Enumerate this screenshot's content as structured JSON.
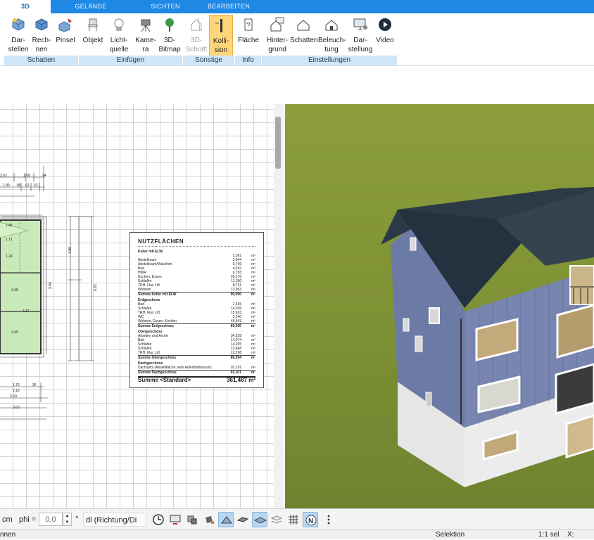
{
  "tabs": [
    {
      "label": "3D"
    },
    {
      "label": "GELÄNDE"
    },
    {
      "label": "SICHTEN"
    },
    {
      "label": "BEARBEITEN"
    }
  ],
  "ribbon": {
    "buttons": [
      {
        "label": "Dar-\nstellen",
        "icon": "cube-view-icon"
      },
      {
        "label": "Rech-\nnen",
        "icon": "cube-render-icon"
      },
      {
        "label": "Pinsel",
        "icon": "brush-cube-icon"
      },
      {
        "label": "Objekt",
        "icon": "chair-icon"
      },
      {
        "label": "Licht-\nquelle",
        "icon": "lightbulb-icon"
      },
      {
        "label": "Kame-\nra",
        "icon": "camera-icon"
      },
      {
        "label": "3D-\nBitmap",
        "icon": "tree-icon"
      },
      {
        "label": "3D-\nSchnitt",
        "icon": "section-house-icon"
      },
      {
        "label": "Kolli-\nsion",
        "icon": "collision-icon"
      },
      {
        "label": "Fläche",
        "icon": "area-info-icon"
      },
      {
        "label": "Hinter-\ngrund",
        "icon": "background-house-icon"
      },
      {
        "label": "Schatten",
        "icon": "shadow-house-icon"
      },
      {
        "label": "Beleuch-\ntung",
        "icon": "lighting-house-icon"
      },
      {
        "label": "Dar-\nstellung",
        "icon": "monitor-settings-icon"
      },
      {
        "label": "Video",
        "icon": "play-icon"
      }
    ],
    "groups": [
      {
        "label": "Schatten"
      },
      {
        "label": "Einfügen"
      },
      {
        "label": "Sonstige"
      },
      {
        "label": "Info"
      },
      {
        "label": "Einstellungen"
      }
    ]
  },
  "plan": {
    "dims_top": [
      "2.62",
      "1.68",
      "24",
      "1.80",
      "80",
      "62",
      "52",
      "1.45",
      "1.71",
      "1.24"
    ],
    "dims_mid": [
      "3.45",
      "4.17",
      "3.45",
      "6.82",
      "9.80",
      "4.80"
    ],
    "dims_bottom": [
      "1.75",
      "2.12",
      "36",
      "3.60",
      "3.60"
    ]
  },
  "nutzflaechen": {
    "title": "NUTZFLÄCHEN",
    "sections": [
      {
        "header": "Keller mit ELW",
        "rows": [
          {
            "name": "",
            "value": "2,361",
            "unit": "m²"
          },
          {
            "name": "Abstellraum",
            "value": "3,944",
            "unit": "m²"
          },
          {
            "name": "Abstellraum/Waschen",
            "value": "9,799",
            "unit": "m²"
          },
          {
            "name": "Bad",
            "value": "4,592",
            "unit": "m²"
          },
          {
            "name": "HWR",
            "value": "6,783",
            "unit": "m²"
          },
          {
            "name": "Kochen, Essen",
            "value": "28,176",
            "unit": "m²"
          },
          {
            "name": "Schlafen",
            "value": "11,260",
            "unit": "m²"
          },
          {
            "name": "TRH, Flur, Lift",
            "value": "8,731",
            "unit": "m²"
          },
          {
            "name": "Wohnen",
            "value": "13,963",
            "unit": "m²"
          }
        ],
        "sum_label": "Summe Keller mit ELW",
        "sum_value": "90,596",
        "unit": "m²"
      },
      {
        "header": "Erdgeschoss",
        "rows": [
          {
            "name": "Bad",
            "value": "7,545",
            "unit": "m²"
          },
          {
            "name": "Schlafen",
            "value": "14,035",
            "unit": "m²"
          },
          {
            "name": "TRH, Flur, Lift",
            "value": "15,633",
            "unit": "m²"
          },
          {
            "name": "WC",
            "value": "2,240",
            "unit": "m²"
          },
          {
            "name": "Wohnen, Essen, Kochen",
            "value": "49,943",
            "unit": "m²"
          }
        ],
        "sum_label": "Summe Erdgeschoss",
        "sum_value": "89,396",
        "unit": "m²"
      },
      {
        "header": "Obergeschoss",
        "rows": [
          {
            "name": "Arbeiten und Archiv",
            "value": "34,528",
            "unit": "m²"
          },
          {
            "name": "Bad",
            "value": "14,074",
            "unit": "m²"
          },
          {
            "name": "Schlafen",
            "value": "14,035",
            "unit": "m²"
          },
          {
            "name": "Schlafen",
            "value": "13,868",
            "unit": "m²"
          },
          {
            "name": "TRH, Flur, Lift",
            "value": "12,768",
            "unit": "m²"
          }
        ],
        "sum_label": "Summe Obergeschoss",
        "sum_value": "89,394",
        "unit": "m²"
      },
      {
        "header": "Dachgeschoss",
        "rows": [
          {
            "name": "Dachspitz (Abstellfläche, kein Aufenthaltsraum)",
            "value": "92,101",
            "unit": "m²"
          }
        ],
        "sum_label": "Summe Dachgeschoss",
        "sum_value": "92,101",
        "unit": "m²"
      }
    ],
    "total_label": "Summe <Standard>",
    "total_value": "361,487 m²"
  },
  "statusbar": {
    "unit": "cm",
    "phi_label": "phi =",
    "phi_value": "0,0",
    "phi_unit": "°",
    "direction_select": "dl (Richtung/Di",
    "icons": [
      "clock-icon",
      "screen-icon",
      "layers-stamp-icon",
      "bucket-icon",
      "wall-draw-icon",
      "multi-wall-icon",
      "floor-plane-icon",
      "stack-icon",
      "grid-icon",
      "north-icon",
      "more-vertical-icon"
    ]
  },
  "bottom": {
    "left": "nnen",
    "mode": "Selektion",
    "scale": "1:1 sel",
    "coord": "X:"
  },
  "colors": {
    "tabbar": "#1e88e5",
    "ribbon_group": "#cfe6f8",
    "active_button": "#ffd57a",
    "grass": "#7c8f33",
    "facade": "#6c7aa6",
    "roof": "#2b3a46"
  }
}
